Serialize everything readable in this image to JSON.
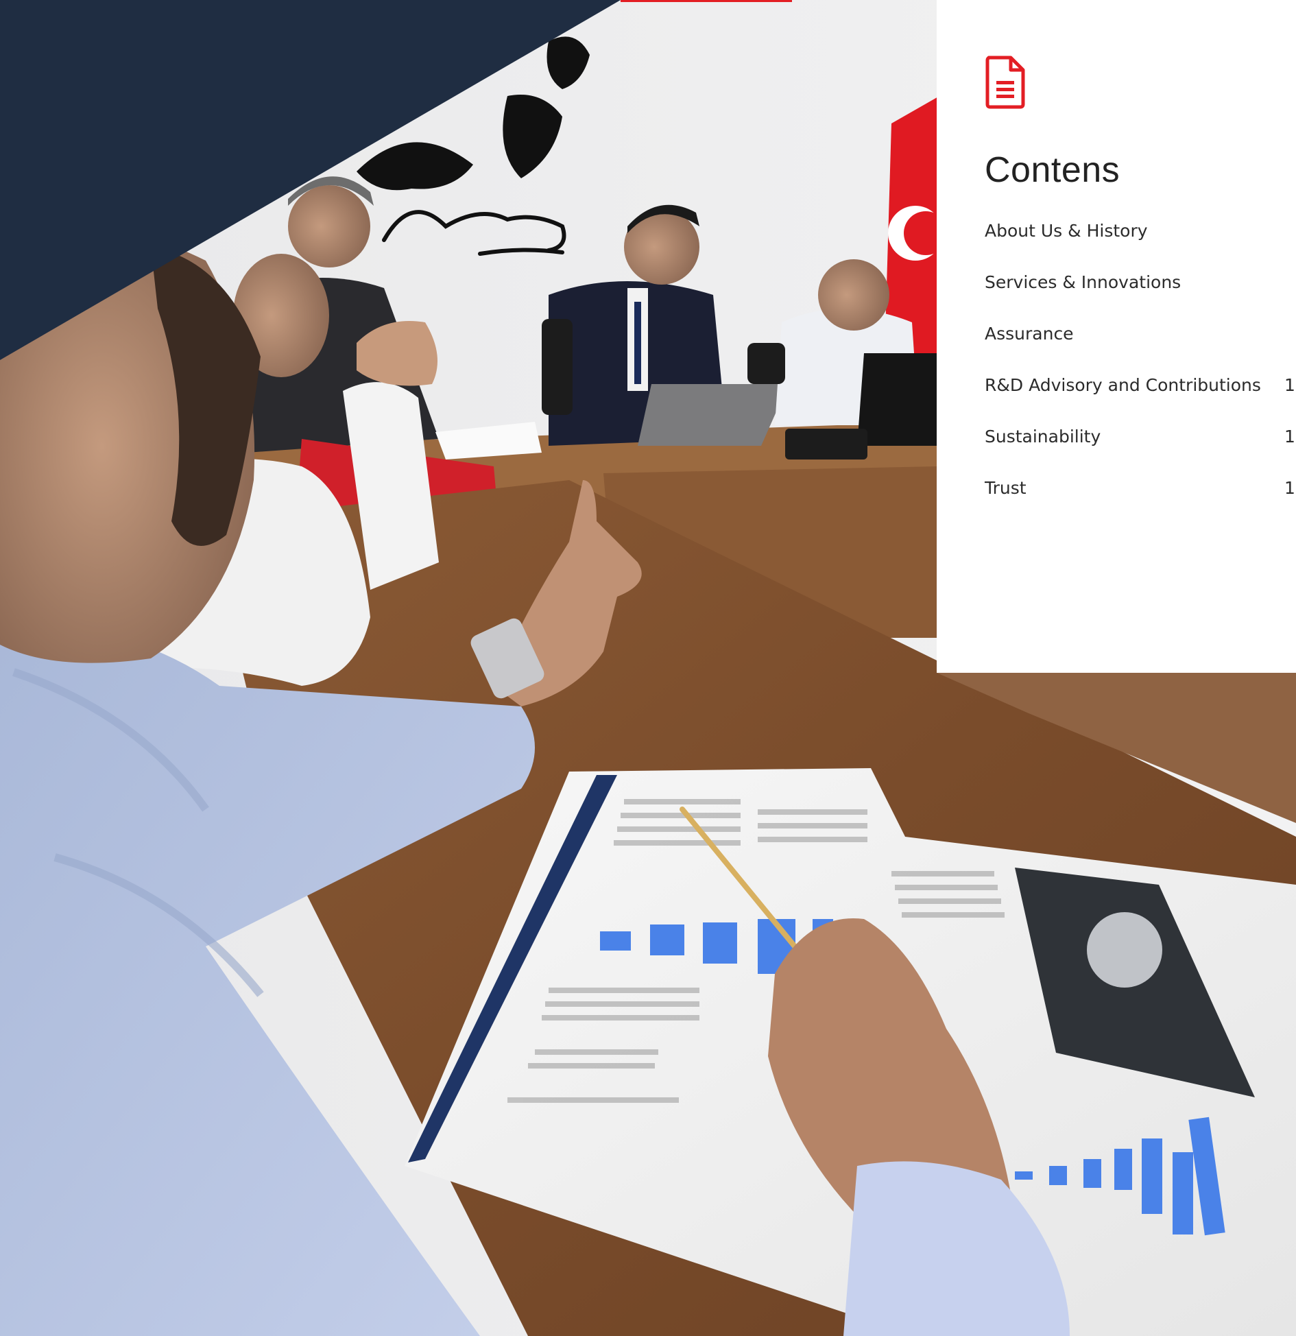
{
  "contents": {
    "title": "Contens",
    "icon": "document-icon",
    "accent_color": "#e31e24",
    "items": [
      {
        "label": "About Us & History",
        "page": ""
      },
      {
        "label": "Services & Innovations",
        "page": ""
      },
      {
        "label": "Assurance",
        "page": ""
      },
      {
        "label": "R&D Advisory and Contributions",
        "page": "1"
      },
      {
        "label": "Sustainability",
        "page": "1"
      },
      {
        "label": "Trust",
        "page": "1"
      }
    ]
  },
  "photo": {
    "wall_signature": "K. Atatürk"
  },
  "colors": {
    "navy": "#1f2d42",
    "accent": "#e31e24"
  }
}
